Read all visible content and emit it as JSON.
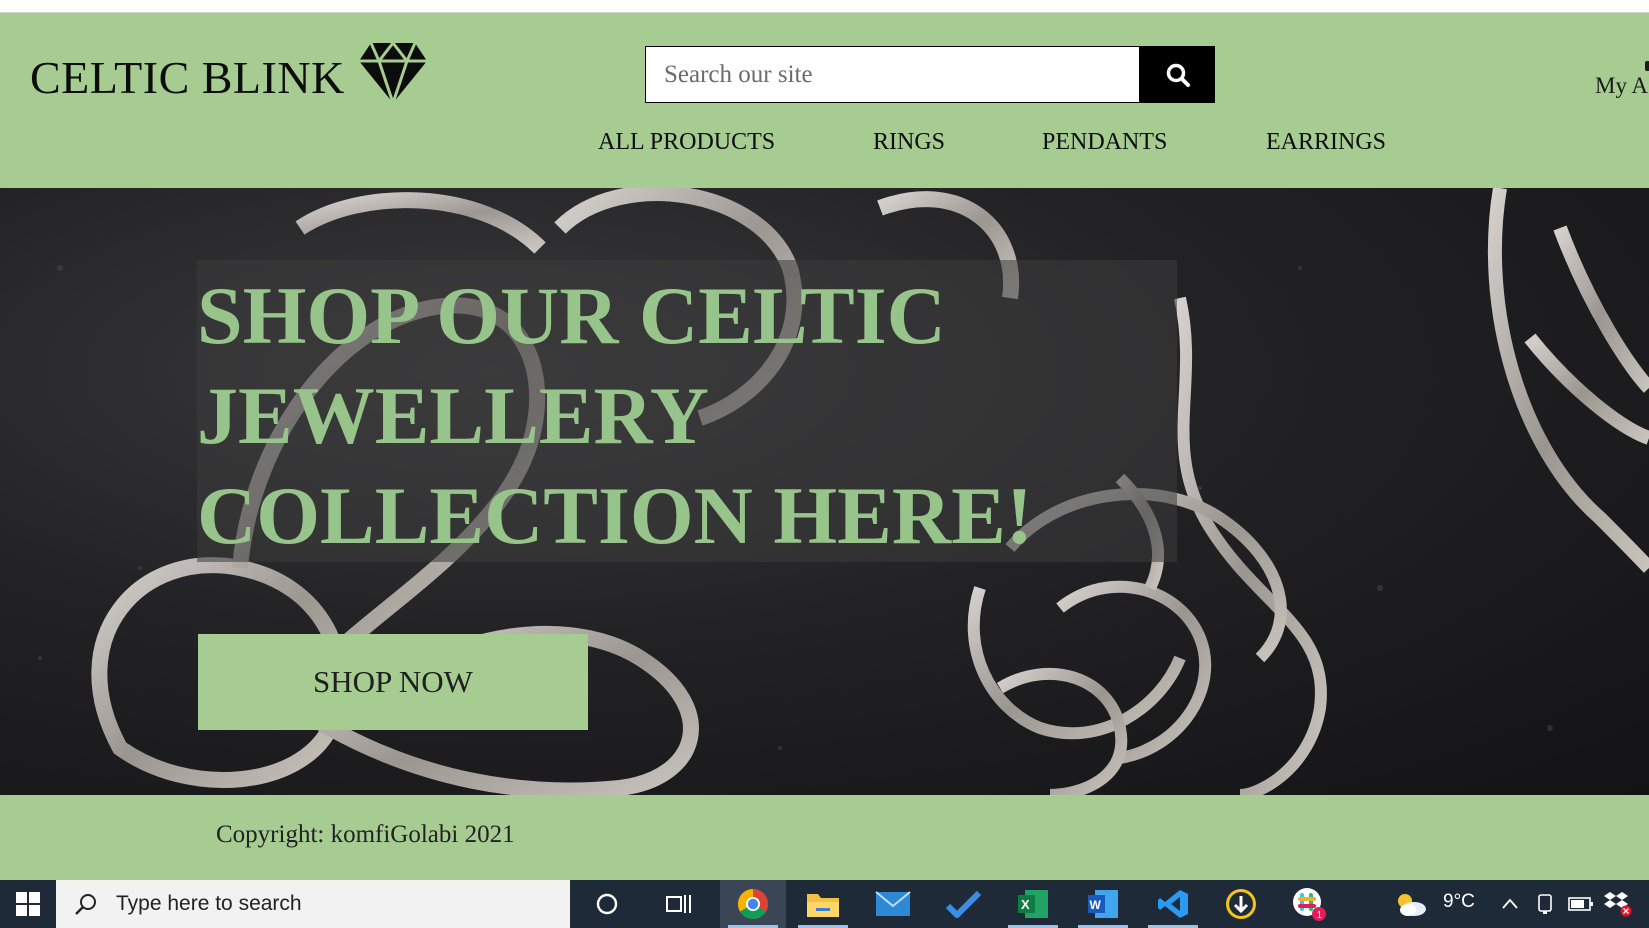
{
  "header": {
    "brand": "CELTIC BLINK",
    "search_placeholder": "Search our site",
    "account_label": "My A"
  },
  "nav": {
    "items": [
      {
        "label": "ALL PRODUCTS"
      },
      {
        "label": "RINGS"
      },
      {
        "label": "PENDANTS"
      },
      {
        "label": "EARRINGS"
      }
    ]
  },
  "hero": {
    "title_lines": [
      "SHOP OUR CELTIC",
      "JEWELLERY",
      "COLLECTION HERE!"
    ],
    "cta_label": "SHOP NOW"
  },
  "footer": {
    "copyright": "Copyright: komfiGolabi 2021"
  },
  "taskbar": {
    "search_text": "Type here to search",
    "weather_temp": "9°C",
    "slack_badge": "1",
    "icons": [
      "windows-start-icon",
      "cortana-icon",
      "task-view-icon",
      "chrome-icon",
      "file-explorer-icon",
      "mail-icon",
      "todo-icon",
      "excel-icon",
      "word-icon",
      "vscode-icon",
      "download-icon",
      "slack-icon",
      "weather-icon"
    ]
  },
  "colors": {
    "brand_green": "#a6cc91",
    "hero_text_green": "#97c48a",
    "taskbar": "#1e2a38"
  }
}
